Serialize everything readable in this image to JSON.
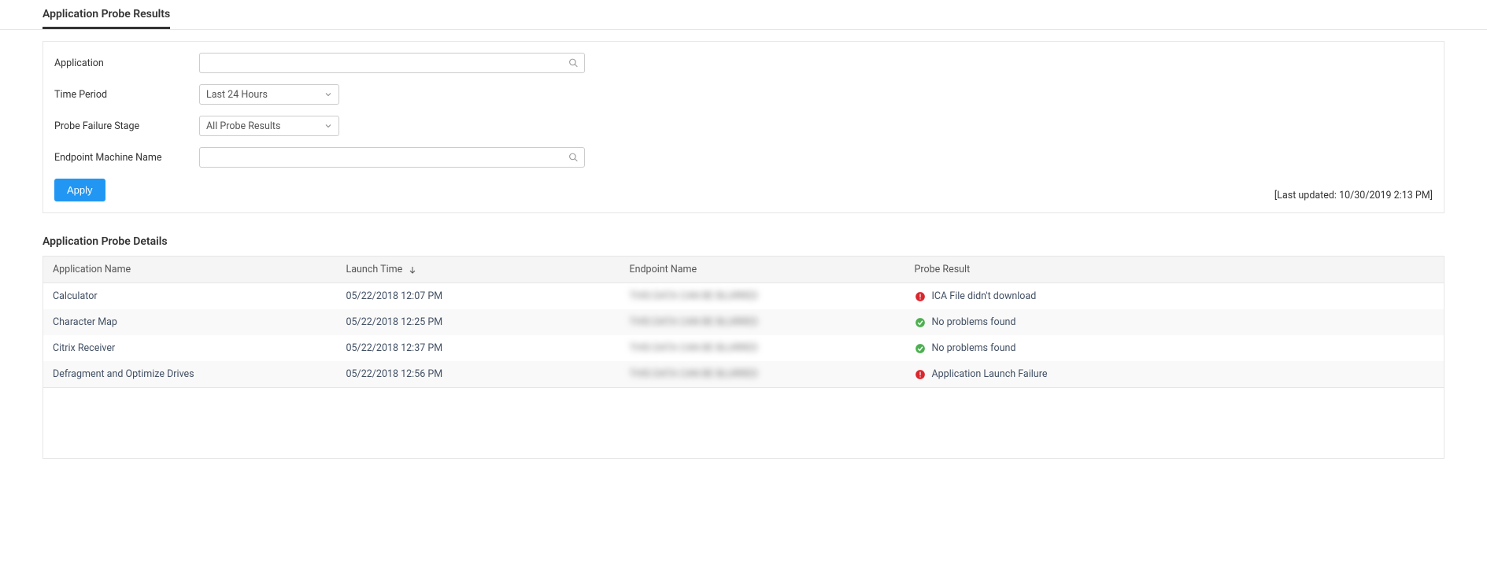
{
  "tab": {
    "title": "Application Probe Results"
  },
  "filters": {
    "application_label": "Application",
    "time_period_label": "Time Period",
    "time_period_value": "Last 24 Hours",
    "probe_failure_label": "Probe Failure Stage",
    "probe_failure_value": "All Probe Results",
    "endpoint_label": "Endpoint Machine Name",
    "apply_label": "Apply",
    "last_updated": "[Last updated: 10/30/2019 2:13 PM]"
  },
  "details": {
    "title": "Application Probe Details",
    "columns": {
      "app_name": "Application Name",
      "launch_time": "Launch Time",
      "endpoint_name": "Endpoint Name",
      "probe_result": "Probe Result"
    },
    "rows": [
      {
        "app": "Calculator",
        "launch": "05/22/2018 12:07 PM",
        "endpoint": "THIS DATA CAN BE BLURRED",
        "status": "error",
        "result": "ICA File didn't download"
      },
      {
        "app": "Character Map",
        "launch": "05/22/2018 12:25 PM",
        "endpoint": "THIS DATA CAN BE BLURRED",
        "status": "success",
        "result": "No problems found"
      },
      {
        "app": "Citrix Receiver",
        "launch": "05/22/2018 12:37 PM",
        "endpoint": "THIS DATA CAN BE BLURRED",
        "status": "success",
        "result": "No problems found"
      },
      {
        "app": "Defragment and Optimize Drives",
        "launch": "05/22/2018 12:56 PM",
        "endpoint": "THIS DATA CAN BE BLURRED",
        "status": "error",
        "result": "Application Launch Failure"
      }
    ]
  }
}
